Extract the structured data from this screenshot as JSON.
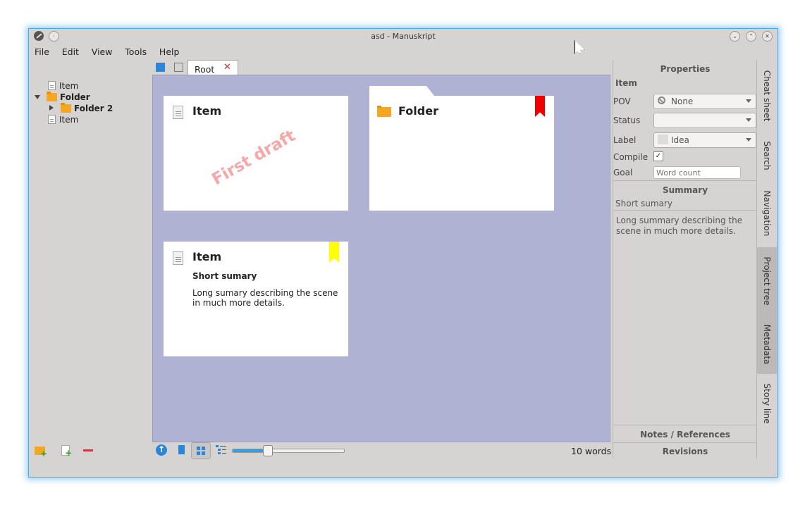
{
  "window": {
    "title": "asd - Manuskript"
  },
  "menu": [
    "File",
    "Edit",
    "View",
    "Tools",
    "Help"
  ],
  "tree": [
    {
      "label": "Item",
      "type": "doc",
      "bold": false
    },
    {
      "label": "Folder",
      "type": "folder",
      "bold": true
    },
    {
      "label": "Folder 2",
      "type": "folder",
      "bold": true
    },
    {
      "label": "Item",
      "type": "doc",
      "bold": false
    }
  ],
  "tab": {
    "label": "Root"
  },
  "cards": [
    {
      "title": "Item",
      "stamp": "First draft"
    },
    {
      "title": "Folder",
      "bookmark_color": "#ff0000"
    },
    {
      "title": "Item",
      "summary": "Short sumary",
      "description": "Long sumary describing the scene in much more details.",
      "bookmark_color": "#ffff00"
    }
  ],
  "status": {
    "word_count": "10 words",
    "zoom": 0.31
  },
  "properties": {
    "header": "Properties",
    "item_title": "Item",
    "pov_label": "POV",
    "pov_value": "None",
    "status_label": "Status",
    "status_value": "",
    "label_label": "Label",
    "label_value": "Idea",
    "compile_label": "Compile",
    "compile_checked": true,
    "goal_label": "Goal",
    "goal_placeholder": "Word count",
    "summary_header": "Summary",
    "short_summary": "Short sumary",
    "long_summary": "Long summary describing the scene in much more details.",
    "notes_header": "Notes / References",
    "revisions_header": "Revisions"
  },
  "side_tabs": [
    "Cheat sheet",
    "Search",
    "Navigation",
    "Project tree",
    "Metadata",
    "Story line"
  ]
}
